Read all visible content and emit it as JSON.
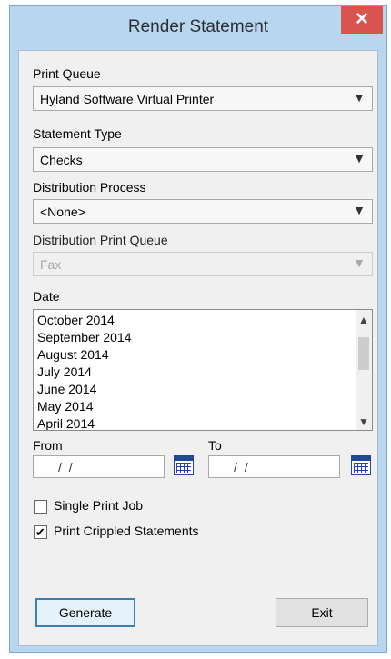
{
  "window": {
    "title": "Render Statement",
    "close_glyph": "✕"
  },
  "form": {
    "print_queue": {
      "label": "Print Queue",
      "value": "Hyland Software Virtual Printer"
    },
    "statement_type": {
      "label": "Statement Type",
      "value": "Checks"
    },
    "distribution_process": {
      "label": "Distribution Process",
      "value": "<None>"
    },
    "distribution_print_queue": {
      "label": "Distribution Print Queue",
      "value": "Fax",
      "disabled": true
    },
    "date": {
      "label": "Date",
      "items": [
        "October 2014",
        "September 2014",
        "August 2014",
        "July 2014",
        "June 2014",
        "May 2014",
        "April 2014"
      ]
    },
    "from": {
      "label": "From",
      "value": "/ /"
    },
    "to": {
      "label": "To",
      "value": "/ /"
    },
    "single_print_job": {
      "label": "Single Print Job",
      "checked": false
    },
    "print_crippled": {
      "label": "Print Crippled Statements",
      "checked": true,
      "glyph": "✔"
    }
  },
  "buttons": {
    "generate": "Generate",
    "exit": "Exit"
  },
  "icons": {
    "dropdown": "▼",
    "scroll_up": "▲",
    "scroll_down": "▼",
    "calendar": "calendar-icon"
  },
  "colors": {
    "title_bar": "#b9d6ef",
    "close": "#d9534f",
    "calendar": "#23489a"
  }
}
